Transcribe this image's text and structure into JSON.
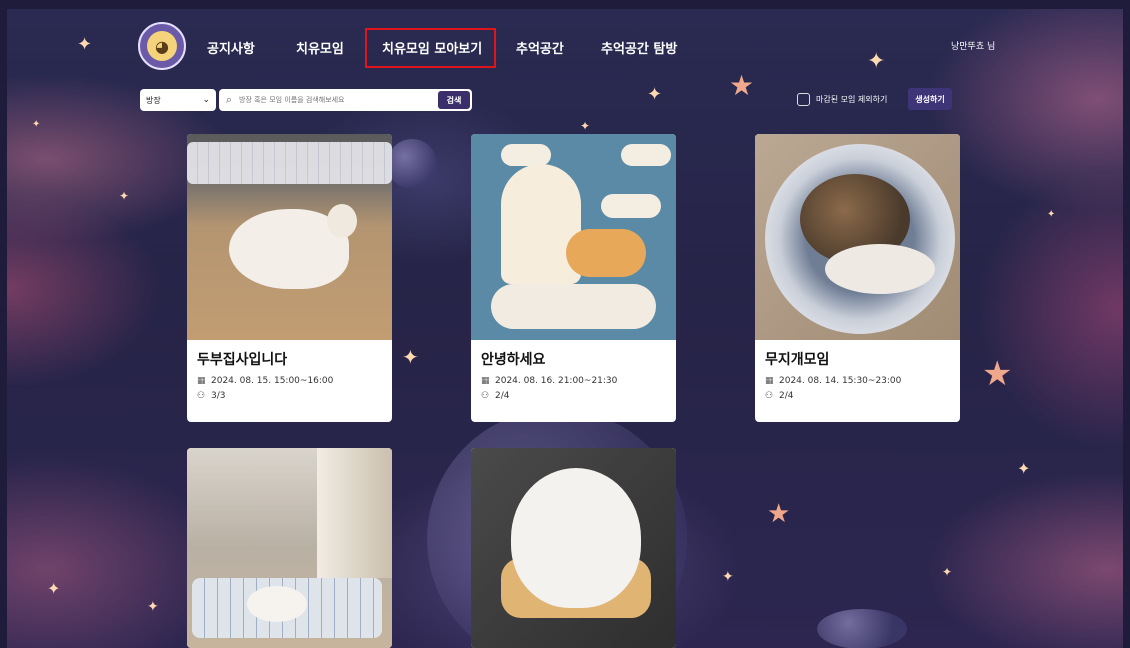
{
  "header": {
    "nav": [
      {
        "label": "공지사항"
      },
      {
        "label": "치유모임"
      },
      {
        "label": "치유모임 모아보기"
      },
      {
        "label": "추억공간"
      },
      {
        "label": "추억공간 탐방"
      }
    ],
    "user": "낭만뚜쵸 님"
  },
  "toolbar": {
    "select_value": "방장",
    "search_placeholder": "방장 혹은 모임 이름을 검색해보세요",
    "search_button": "검색",
    "filter_label": "마감된 모임 제외하기",
    "create_button": "생성하기"
  },
  "cards": [
    {
      "title": "두부집사입니다",
      "datetime": "2024. 08. 15. 15:00~16:00",
      "members": "3/3"
    },
    {
      "title": "안녕하세요",
      "datetime": "2024. 08. 16. 21:00~21:30",
      "members": "2/4"
    },
    {
      "title": "무지개모임",
      "datetime": "2024. 08. 14. 15:30~23:00",
      "members": "2/4"
    }
  ],
  "colors": {
    "nav_highlight": "#e0151b",
    "button": "#3e3478",
    "background": "#262447"
  },
  "icons": {
    "calendar": "calendar-icon",
    "members": "members-icon",
    "search": "search-icon"
  }
}
